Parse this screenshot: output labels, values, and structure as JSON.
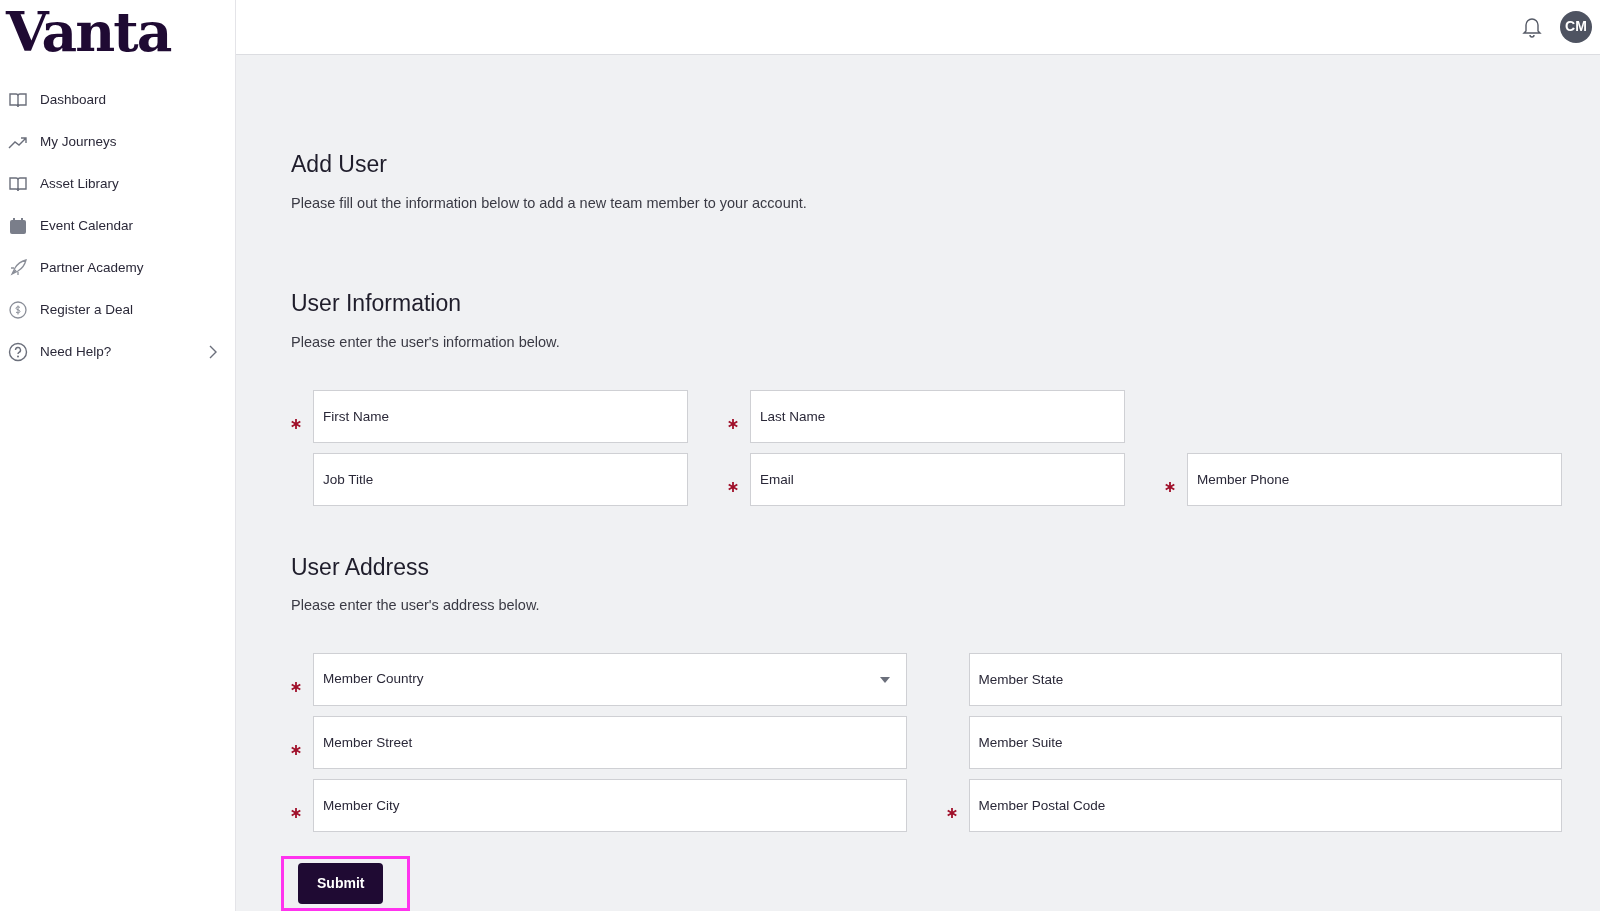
{
  "sidebar": {
    "logo": "Vanta",
    "items": [
      {
        "label": "Dashboard",
        "expandable": false
      },
      {
        "label": "My Journeys",
        "expandable": false
      },
      {
        "label": "Asset Library",
        "expandable": false
      },
      {
        "label": "Event Calendar",
        "expandable": false
      },
      {
        "label": "Partner Academy",
        "expandable": false
      },
      {
        "label": "Register a Deal",
        "expandable": false
      },
      {
        "label": "Need Help?",
        "expandable": true
      }
    ]
  },
  "header": {
    "avatar": "CM"
  },
  "page": {
    "title": "Add User",
    "subtitle": "Please fill out the information below to add a new team member to your account."
  },
  "sections": [
    {
      "title": "User Information",
      "subtitle": "Please enter the user's information below.",
      "fields": [
        {
          "placeholder": "First Name",
          "required": true,
          "kind": "text"
        },
        {
          "placeholder": "Last Name",
          "required": true,
          "kind": "text"
        },
        {
          "kind": "empty"
        },
        {
          "placeholder": "Job Title",
          "required": false,
          "kind": "text"
        },
        {
          "placeholder": "Email",
          "required": true,
          "kind": "text"
        },
        {
          "placeholder": "Member Phone",
          "required": true,
          "kind": "text"
        }
      ]
    },
    {
      "title": "User Address",
      "subtitle": "Please enter the user's address below.",
      "fields": [
        {
          "placeholder": "Member Country",
          "required": true,
          "kind": "select"
        },
        {
          "placeholder": "Member State",
          "required": false,
          "kind": "text"
        },
        {
          "placeholder": "Member Street",
          "required": true,
          "kind": "text"
        },
        {
          "placeholder": "Member Suite",
          "required": false,
          "kind": "text"
        },
        {
          "placeholder": "Member City",
          "required": true,
          "kind": "text"
        },
        {
          "placeholder": "Member Postal Code",
          "required": true,
          "kind": "text"
        }
      ]
    }
  ],
  "submit": {
    "label": "Submit",
    "highlighted": true
  }
}
